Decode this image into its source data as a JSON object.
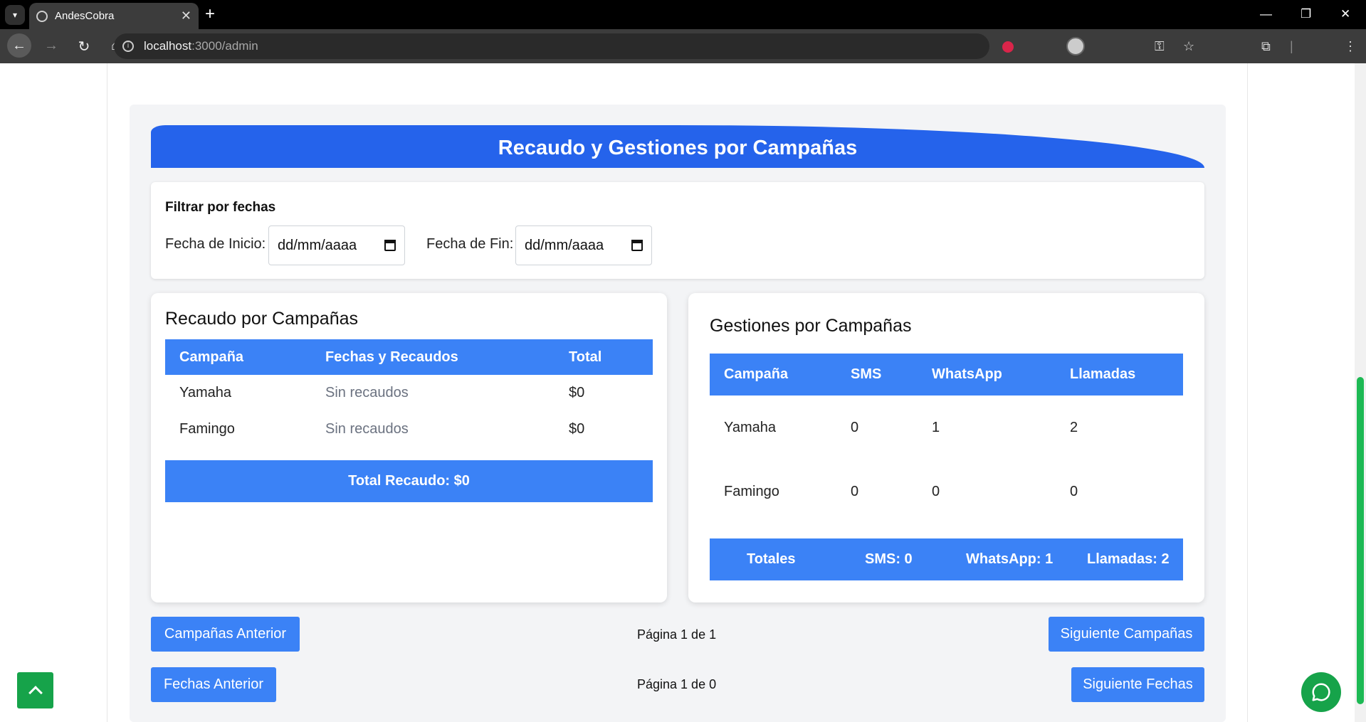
{
  "browser": {
    "tab_title": "AndesCobra",
    "url_host": "localhost",
    "url_path": ":3000/admin"
  },
  "banner": {
    "title": "Recaudo y Gestiones por Campañas"
  },
  "filter": {
    "title": "Filtrar por fechas",
    "start_label": "Fecha de Inicio:",
    "end_label": "Fecha de Fin:",
    "start_value": "dd/mm/aaaa",
    "end_value": "dd/mm/aaaa"
  },
  "recaudo": {
    "title": "Recaudo por Campañas",
    "headers": [
      "Campaña",
      "Fechas y Recaudos",
      "Total"
    ],
    "rows": [
      {
        "campaign": "Yamaha",
        "dates": "Sin recaudos",
        "total": "$0"
      },
      {
        "campaign": "Famingo",
        "dates": "Sin recaudos",
        "total": "$0"
      }
    ],
    "total_label": "Total Recaudo: $0"
  },
  "gestiones": {
    "title": "Gestiones por Campañas",
    "headers": [
      "Campaña",
      "SMS",
      "WhatsApp",
      "Llamadas"
    ],
    "rows": [
      {
        "campaign": "Yamaha",
        "sms": "0",
        "whatsapp": "1",
        "calls": "2"
      },
      {
        "campaign": "Famingo",
        "sms": "0",
        "whatsapp": "0",
        "calls": "0"
      }
    ],
    "totals": {
      "label": "Totales",
      "sms": "SMS: 0",
      "whatsapp": "WhatsApp: 1",
      "calls": "Llamadas: 2"
    }
  },
  "pagination": {
    "campaigns_prev": "Campañas Anterior",
    "campaigns_info": "Página 1 de 1",
    "campaigns_next": "Siguiente Campañas",
    "dates_prev": "Fechas Anterior",
    "dates_info": "Página 1 de 0",
    "dates_next": "Siguiente Fechas"
  },
  "colors": {
    "primary": "#3b82f6",
    "banner": "#2563eb",
    "success": "#16a34a"
  }
}
